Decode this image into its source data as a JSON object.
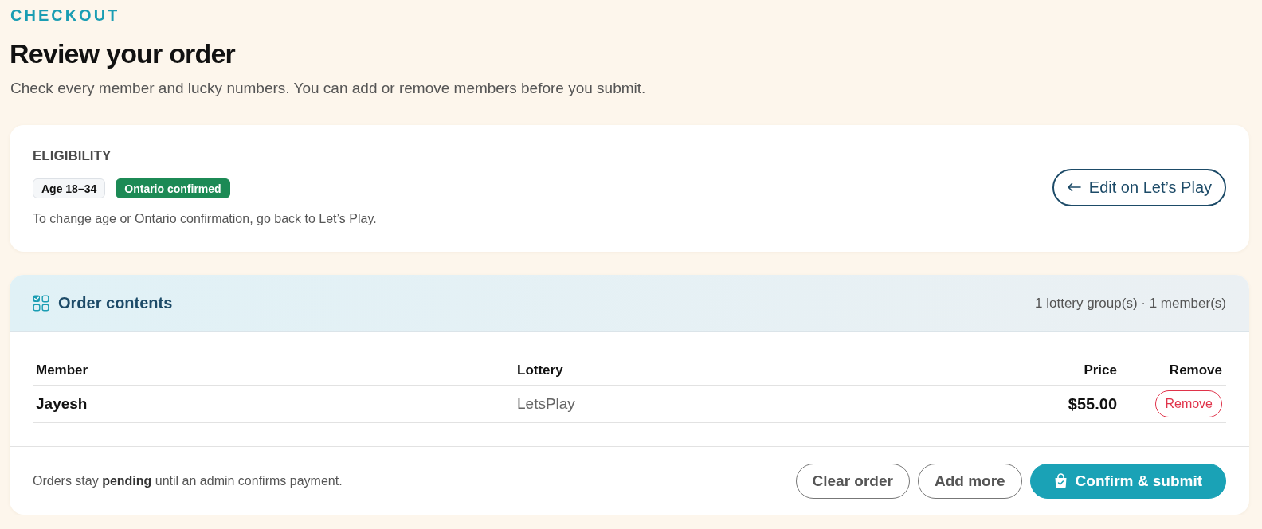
{
  "header": {
    "eyebrow": "CHECKOUT",
    "title": "Review your order",
    "subtitle": "Check every member and lucky numbers. You can add or remove members before you submit."
  },
  "eligibility": {
    "title": "ELIGIBILITY",
    "badges": [
      {
        "label": "Age 18–34",
        "kind": "neutral"
      },
      {
        "label": "Ontario confirmed",
        "kind": "success"
      }
    ],
    "note": "To change age or Ontario confirmation, go back to Let’s Play.",
    "edit_button": "Edit on Let’s Play"
  },
  "order": {
    "title": "Order contents",
    "summary": "1 lottery group(s) · 1 member(s)",
    "columns": [
      "Member",
      "Lottery",
      "Price",
      "Remove"
    ],
    "rows": [
      {
        "member": "Jayesh",
        "lottery": "LetsPlay",
        "price": "$55.00",
        "remove": "Remove"
      }
    ],
    "footer_note": "Orders stay **pending** until an admin confirms payment.",
    "actions": [
      {
        "label": "Clear order",
        "kind": "outline"
      },
      {
        "label": "Add more",
        "kind": "outline"
      },
      {
        "label": "Confirm & submit",
        "kind": "primary"
      }
    ]
  }
}
